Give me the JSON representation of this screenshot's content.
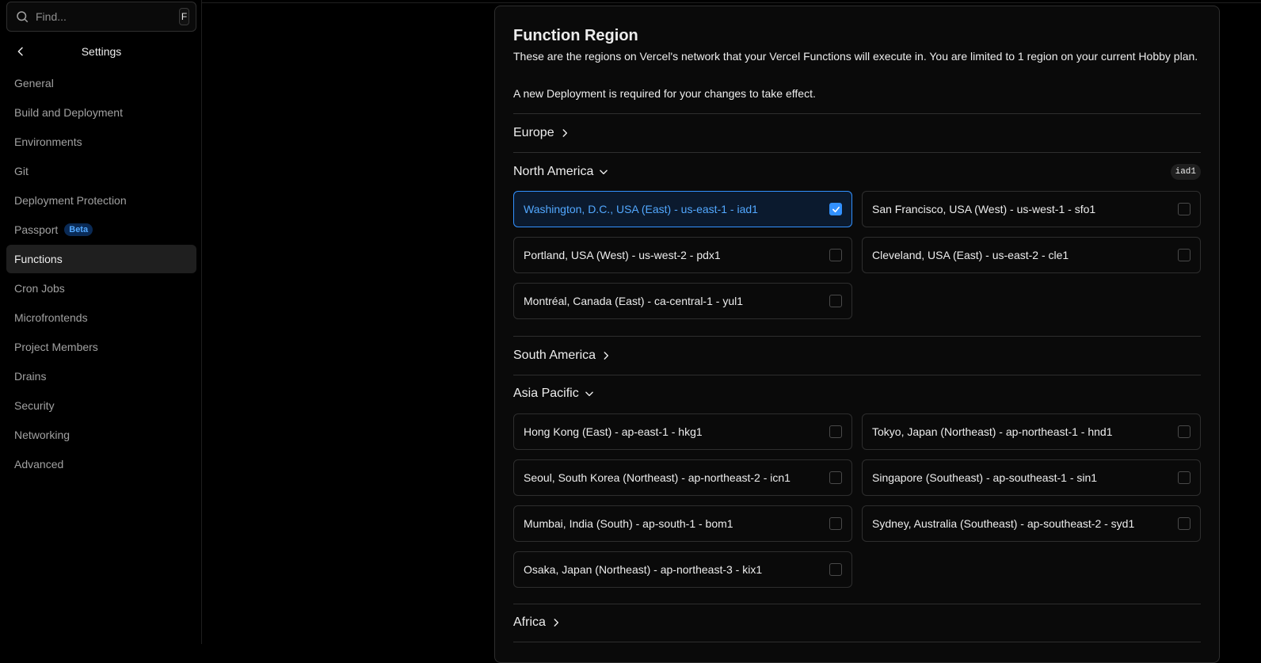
{
  "search": {
    "placeholder": "Find...",
    "shortcut": "F"
  },
  "sidebar": {
    "title": "Settings",
    "items": [
      {
        "label": "General"
      },
      {
        "label": "Build and Deployment"
      },
      {
        "label": "Environments"
      },
      {
        "label": "Git"
      },
      {
        "label": "Deployment Protection"
      },
      {
        "label": "Passport",
        "badge": "Beta"
      },
      {
        "label": "Functions",
        "active": true
      },
      {
        "label": "Cron Jobs"
      },
      {
        "label": "Microfrontends"
      },
      {
        "label": "Project Members"
      },
      {
        "label": "Drains"
      },
      {
        "label": "Security"
      },
      {
        "label": "Networking"
      },
      {
        "label": "Advanced"
      }
    ]
  },
  "main": {
    "title": "Function Region",
    "description": "These are the regions on Vercel's network that your Vercel Functions will execute in. You are limited to 1 region on your current Hobby plan.",
    "note": "A new Deployment is required for your changes to take effect.",
    "sections": {
      "europe": {
        "label": "Europe",
        "expanded": false
      },
      "north_america": {
        "label": "North America",
        "expanded": true,
        "selected_badge": "iad1",
        "regions": [
          {
            "label": "Washington, D.C., USA (East) - us-east-1 - iad1",
            "checked": true
          },
          {
            "label": "San Francisco, USA (West) - us-west-1 - sfo1",
            "checked": false
          },
          {
            "label": "Portland, USA (West) - us-west-2 - pdx1",
            "checked": false
          },
          {
            "label": "Cleveland, USA (East) - us-east-2 - cle1",
            "checked": false
          },
          {
            "label": "Montréal, Canada (East) - ca-central-1 - yul1",
            "checked": false
          }
        ]
      },
      "south_america": {
        "label": "South America",
        "expanded": false
      },
      "asia_pacific": {
        "label": "Asia Pacific",
        "expanded": true,
        "regions": [
          {
            "label": "Hong Kong (East) - ap-east-1 - hkg1",
            "checked": false
          },
          {
            "label": "Tokyo, Japan (Northeast) - ap-northeast-1 - hnd1",
            "checked": false
          },
          {
            "label": "Seoul, South Korea (Northeast) - ap-northeast-2 - icn1",
            "checked": false
          },
          {
            "label": "Singapore (Southeast) - ap-southeast-1 - sin1",
            "checked": false
          },
          {
            "label": "Mumbai, India (South) - ap-south-1 - bom1",
            "checked": false
          },
          {
            "label": "Sydney, Australia (Southeast) - ap-southeast-2 - syd1",
            "checked": false
          },
          {
            "label": "Osaka, Japan (Northeast) - ap-northeast-3 - kix1",
            "checked": false
          }
        ]
      },
      "africa": {
        "label": "Africa",
        "expanded": false
      }
    }
  },
  "colors": {
    "accent": "#3291ff",
    "badge_bg": "#0a2a55",
    "badge_text": "#52a8ff"
  }
}
